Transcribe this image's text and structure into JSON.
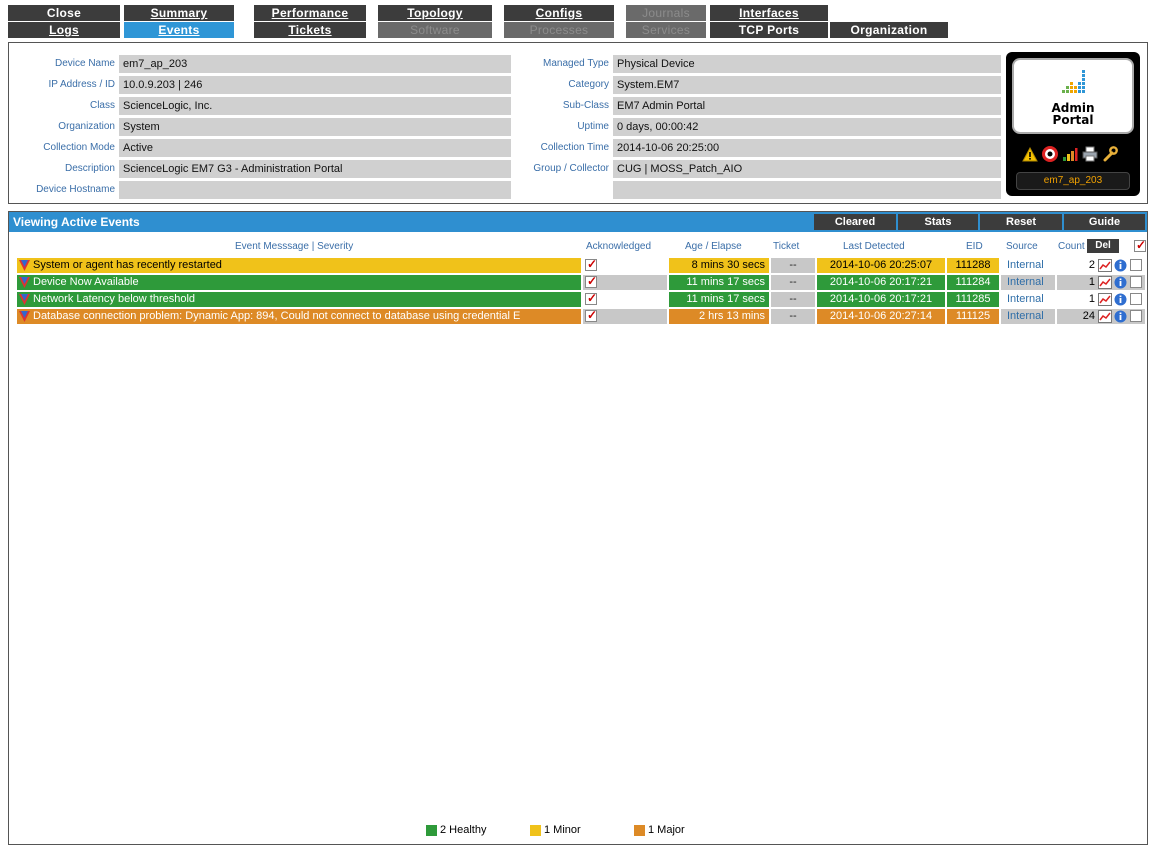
{
  "tabs": {
    "row1": [
      {
        "label": "Close",
        "underline": "",
        "state": "normal"
      },
      {
        "label": "Summary",
        "underline": "S",
        "state": "normal"
      },
      {
        "label": "Performance",
        "underline": "P",
        "state": "normal"
      },
      {
        "label": "Topology",
        "underline": "To",
        "state": "normal"
      },
      {
        "label": "Configs",
        "underline": "C",
        "state": "normal"
      },
      {
        "label": "Journals",
        "underline": "",
        "state": "disabled"
      },
      {
        "label": "Interfaces",
        "underline": "I",
        "state": "normal"
      }
    ],
    "row2": [
      {
        "label": "Logs",
        "underline": "L",
        "state": "normal"
      },
      {
        "label": "Events",
        "underline": "E",
        "state": "active"
      },
      {
        "label": "Tickets",
        "underline": "T",
        "state": "normal"
      },
      {
        "label": "Software",
        "underline": "",
        "state": "disabled"
      },
      {
        "label": "Processes",
        "underline": "",
        "state": "disabled"
      },
      {
        "label": "Services",
        "underline": "",
        "state": "disabled"
      },
      {
        "label": "TCP Ports",
        "underline": "",
        "state": "normal"
      },
      {
        "label": "Organization",
        "underline": "",
        "state": "normal"
      }
    ]
  },
  "device": {
    "left": [
      {
        "label": "Device Name",
        "value": "em7_ap_203"
      },
      {
        "label": "IP Address / ID",
        "value": "10.0.9.203 | 246"
      },
      {
        "label": "Class",
        "value": "ScienceLogic, Inc."
      },
      {
        "label": "Organization",
        "value": "System"
      },
      {
        "label": "Collection Mode",
        "value": "Active"
      },
      {
        "label": "Description",
        "value": "ScienceLogic EM7 G3 - Administration Portal"
      },
      {
        "label": "Device Hostname",
        "value": ""
      }
    ],
    "right": [
      {
        "label": "Managed Type",
        "value": "Physical Device"
      },
      {
        "label": "Category",
        "value": "System.EM7"
      },
      {
        "label": "Sub-Class",
        "value": "EM7 Admin Portal"
      },
      {
        "label": "Uptime",
        "value": "0 days, 00:00:42"
      },
      {
        "label": "Collection Time",
        "value": "2014-10-06 20:25:00"
      },
      {
        "label": "Group / Collector",
        "value": "CUG | MOSS_Patch_AIO"
      },
      {
        "label": "",
        "value": ""
      }
    ],
    "card_title_line1": "Admin",
    "card_title_line2": "Portal",
    "card_name": "em7_ap_203",
    "card_icons": [
      "warning-icon",
      "lifebuoy-icon",
      "signal-bars-icon",
      "printer-icon",
      "wrench-icon"
    ]
  },
  "events": {
    "title": "Viewing Active Events",
    "buttons": [
      "Cleared",
      "Stats",
      "Reset",
      "Guide"
    ],
    "columns": {
      "message": "Event Messsage | Severity",
      "ack": "Acknowledged",
      "age": "Age / Elapse",
      "ticket": "Ticket",
      "last": "Last Detected",
      "eid": "EID",
      "source": "Source",
      "count": "Count",
      "del": "Del"
    },
    "rows": [
      {
        "message": "System or agent has recently restarted",
        "severity": "minor",
        "acknowledged": true,
        "age": "8 mins 30 secs",
        "ticket": "--",
        "last": "2014-10-06 20:25:07",
        "eid": "111288",
        "source": "Internal",
        "count": "2"
      },
      {
        "message": "Device Now Available",
        "severity": "healthy",
        "acknowledged": true,
        "age": "11 mins 17 secs",
        "ticket": "--",
        "last": "2014-10-06 20:17:21",
        "eid": "111284",
        "source": "Internal",
        "count": "1"
      },
      {
        "message": "Network Latency below threshold",
        "severity": "healthy",
        "acknowledged": true,
        "age": "11 mins 17 secs",
        "ticket": "--",
        "last": "2014-10-06 20:17:21",
        "eid": "111285",
        "source": "Internal",
        "count": "1"
      },
      {
        "message": "Database connection problem: Dynamic App: 894, Could not connect to database using credential E",
        "severity": "major",
        "acknowledged": true,
        "age": "2 hrs 13 mins",
        "ticket": "--",
        "last": "2014-10-06 20:27:14",
        "eid": "111125",
        "source": "Internal",
        "count": "24"
      }
    ],
    "legend": [
      {
        "label": "2 Healthy",
        "color": "#2e9a3a"
      },
      {
        "label": "1 Minor",
        "color": "#f0c21a"
      },
      {
        "label": "1 Major",
        "color": "#dd8a26"
      }
    ]
  },
  "colors": {
    "healthy": "#2e9a3a",
    "minor": "#f0c21a",
    "major": "#dd8a26",
    "tab_dark": "#3c3c3c",
    "tab_active": "#2f96d6",
    "header_blue": "#2f8fd0",
    "label_blue": "#3a6ea8",
    "value_gray": "#d0d0d0"
  }
}
